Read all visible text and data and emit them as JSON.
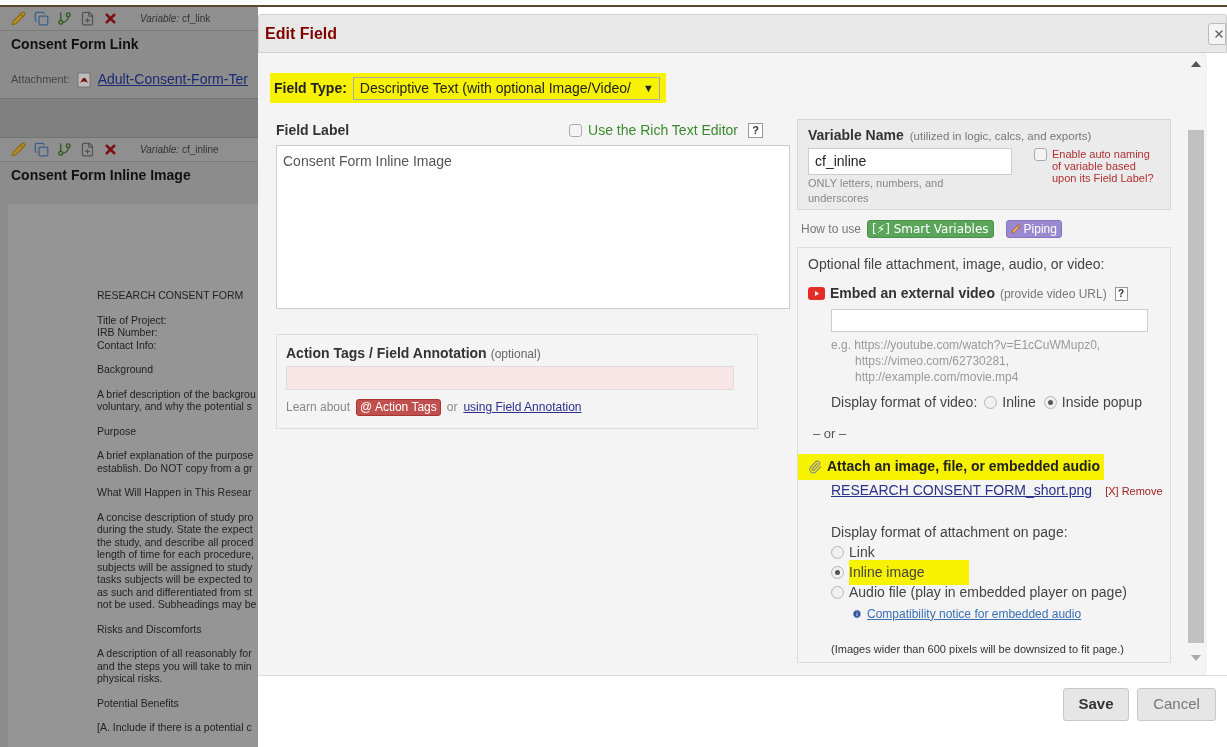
{
  "page_behind": {
    "fields": [
      {
        "variable_label": "Variable:",
        "variable": "cf_link",
        "title": "Consent Form Link",
        "attachment_label": "Attachment:",
        "attachment_link": "Adult-Consent-Form-Ter"
      },
      {
        "variable_label": "Variable:",
        "variable": "cf_inline",
        "title": "Consent Form Inline Image",
        "document": [
          [
            "RESEARCH CONSENT FORM"
          ],
          [
            "Title of Project:",
            "IRB Number:",
            "Contact Info:"
          ],
          [
            "Background"
          ],
          [
            "A brief description of the backgrou",
            "voluntary, and why the potential s"
          ],
          [
            "Purpose"
          ],
          [
            "A brief explanation of the purpose",
            "establish. Do NOT copy from a gr"
          ],
          [
            "What Will Happen in This Resear"
          ],
          [
            "A concise description of study pro",
            "during the study. State the expect",
            "the study, and describe all proced",
            "length of time for each procedure,",
            "subjects will be assigned to study",
            "tasks subjects will be expected to",
            "as such and differentiated from st",
            "not be used. Subheadings may be"
          ],
          [
            "Risks and Discomforts"
          ],
          [
            "A description of all reasonably for",
            "and the steps you will take to min",
            "physical risks."
          ],
          [
            "Potential Benefits"
          ],
          [
            "[A. Include if there is a potential c"
          ]
        ]
      }
    ]
  },
  "dialog": {
    "title": "Edit Field",
    "field_type": {
      "label": "Field Type:",
      "value": "Descriptive Text (with optional Image/Video/",
      "caret": "▼",
      "highlighted": true
    },
    "field_label": {
      "label": "Field Label",
      "rich_text": {
        "label": "Use the Rich Text Editor",
        "checked": false
      },
      "help": "?",
      "value": "Consent Form Inline Image"
    },
    "action_tags": {
      "title": "Action Tags / Field Annotation",
      "note": "(optional)",
      "learn": "Learn about",
      "button": "@ Action Tags",
      "or": "or",
      "link": "using Field Annotation"
    },
    "variable": {
      "title": "Variable Name",
      "note": "(utilized in logic, calcs, and exports)",
      "value": "cf_inline",
      "hint": "ONLY letters, numbers, and underscores",
      "auto_naming": {
        "label": "Enable auto naming of variable based upon its Field Label?",
        "checked": false
      }
    },
    "how_to_use": {
      "label": "How to use",
      "smart_variables": "[⚡] Smart Variables",
      "piping": "Piping"
    },
    "attachment": {
      "title": "Optional file attachment, image, audio, or video:",
      "video_heading": "Embed an external video",
      "video_note": "(provide video URL)",
      "help": "?",
      "example": [
        "e.g. https://youtube.com/watch?v=E1cCuWMupz0,",
        "https://vimeo.com/62730281,",
        "http://example.com/movie.mp4"
      ],
      "video_format_label": "Display format of video:",
      "video_options": [
        {
          "label": "Inline",
          "selected": false
        },
        {
          "label": "Inside popup",
          "selected": true
        }
      ],
      "or": "– or –",
      "attach_heading": "Attach an image, file, or embedded audio",
      "attach_highlighted": true,
      "file_link": "RESEARCH CONSENT FORM_short.png",
      "remove": "[X] Remove",
      "format_label": "Display format of attachment on page:",
      "options": [
        {
          "label": "Link",
          "selected": false,
          "highlighted": false
        },
        {
          "label": "Inline image",
          "selected": true,
          "highlighted": true
        },
        {
          "label": "Audio file (play in embedded player on page)",
          "selected": false,
          "highlighted": false
        }
      ],
      "notice": "Compatibility notice for embedded audio",
      "footnote": "(Images wider than 600 pixels will be downsized to fit page.)"
    },
    "buttons": [
      {
        "label": "Save",
        "kind": "primary"
      },
      {
        "label": "Cancel",
        "kind": "secondary"
      }
    ]
  }
}
